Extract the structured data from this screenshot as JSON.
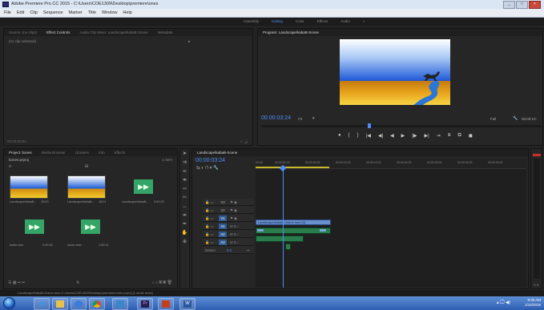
{
  "window": {
    "title": "Adobe Premiere Pro CC 2015 - C:\\Users\\COE1309\\Desktop\\premiere\\ones",
    "controls": [
      "_",
      "□",
      "×"
    ]
  },
  "menu": [
    "File",
    "Edit",
    "Clip",
    "Sequence",
    "Marker",
    "Title",
    "Window",
    "Help"
  ],
  "workspaces": {
    "items": [
      "Assembly",
      "Editing",
      "Color",
      "Effects",
      "Audio"
    ],
    "active": "Editing",
    "more": "»"
  },
  "source_panel": {
    "tabs": [
      "Source: (no clips)",
      "Effect Controls",
      "Audio Clip Mixer: Landscape/kabaB Scene",
      "Metadata"
    ],
    "active_tab": "Effect Controls",
    "message": "(no clip selected)",
    "timecode": "00:00:00:00"
  },
  "program_monitor": {
    "title": "Program: Landscape/kabaB-Scene",
    "timecode": "00:00:03:24",
    "fit": "Fit",
    "quality": "Full",
    "duration": "00:00:10:",
    "transport": [
      "●",
      "{",
      "}",
      "|◀",
      "◀|",
      "◀",
      "▶",
      "|▶",
      "▶|",
      "⇥",
      "⧈",
      "⧉",
      "◼"
    ]
  },
  "project_panel": {
    "tabs": [
      "Project: bones",
      "Media Browser",
      "Libraries",
      "Info",
      "Effects"
    ],
    "active_tab": "Project: bones",
    "name": "bones.prproj",
    "count": "1 Item",
    "search_icon": "search-icon",
    "items": [
      {
        "label": "Landscape/kabaB...",
        "duration": "15:00",
        "kind": "video"
      },
      {
        "label": "Landscape/kabaB...",
        "duration": "18:21",
        "kind": "video"
      },
      {
        "label": "Landscape/kabaB...",
        "duration": "0:00:03",
        "kind": "sequence"
      },
      {
        "label": "audio.wav",
        "duration": "0:00:06",
        "kind": "audio"
      },
      {
        "label": "music.wav",
        "duration": "1:00:01",
        "kind": "audio"
      }
    ]
  },
  "timeline": {
    "tab": "Landscape/kabaB-Scene",
    "timecode": "00:00:03:24",
    "ruler": [
      "00:00",
      "00:00:04:23",
      "00:00:09:23",
      "00:00:14:23",
      "00:00:19:23",
      "00:00:24:23",
      "00:00:29:23",
      "00:00:34:23",
      "00:00:39:22",
      "00:00:44:22",
      "00:00:49:22"
    ],
    "tracks": [
      {
        "name": "V3",
        "label": "V3"
      },
      {
        "name": "V2",
        "label": "V2"
      },
      {
        "name": "V1",
        "label": "V1"
      },
      {
        "name": "A1",
        "label": "A1"
      },
      {
        "name": "A2",
        "label": "A2"
      },
      {
        "name": "A3",
        "label": "A3"
      }
    ],
    "master": {
      "label": "Master",
      "value": "0.0"
    },
    "video_clip": "Landscape/kabaB-Scene.mov [V]"
  },
  "statusbar": "Landscape/kabaB-Scene.mov  C:/Users/COE1309/Desktop/premiere/ones.prproj [1 audio track]",
  "taskbar": {
    "time": "9:35 AM",
    "date": "1/15/2016",
    "apps": [
      "ie-icon",
      "explorer-icon",
      "media-icon",
      "paint-icon",
      "premiere-icon",
      "powerpoint-icon",
      "word-icon"
    ]
  },
  "colors": {
    "accent": "#4d8cf5",
    "clip_green": "#2a7d4b",
    "clip_blue": "#6a8fcd",
    "playhead": "#4d8cf5"
  }
}
